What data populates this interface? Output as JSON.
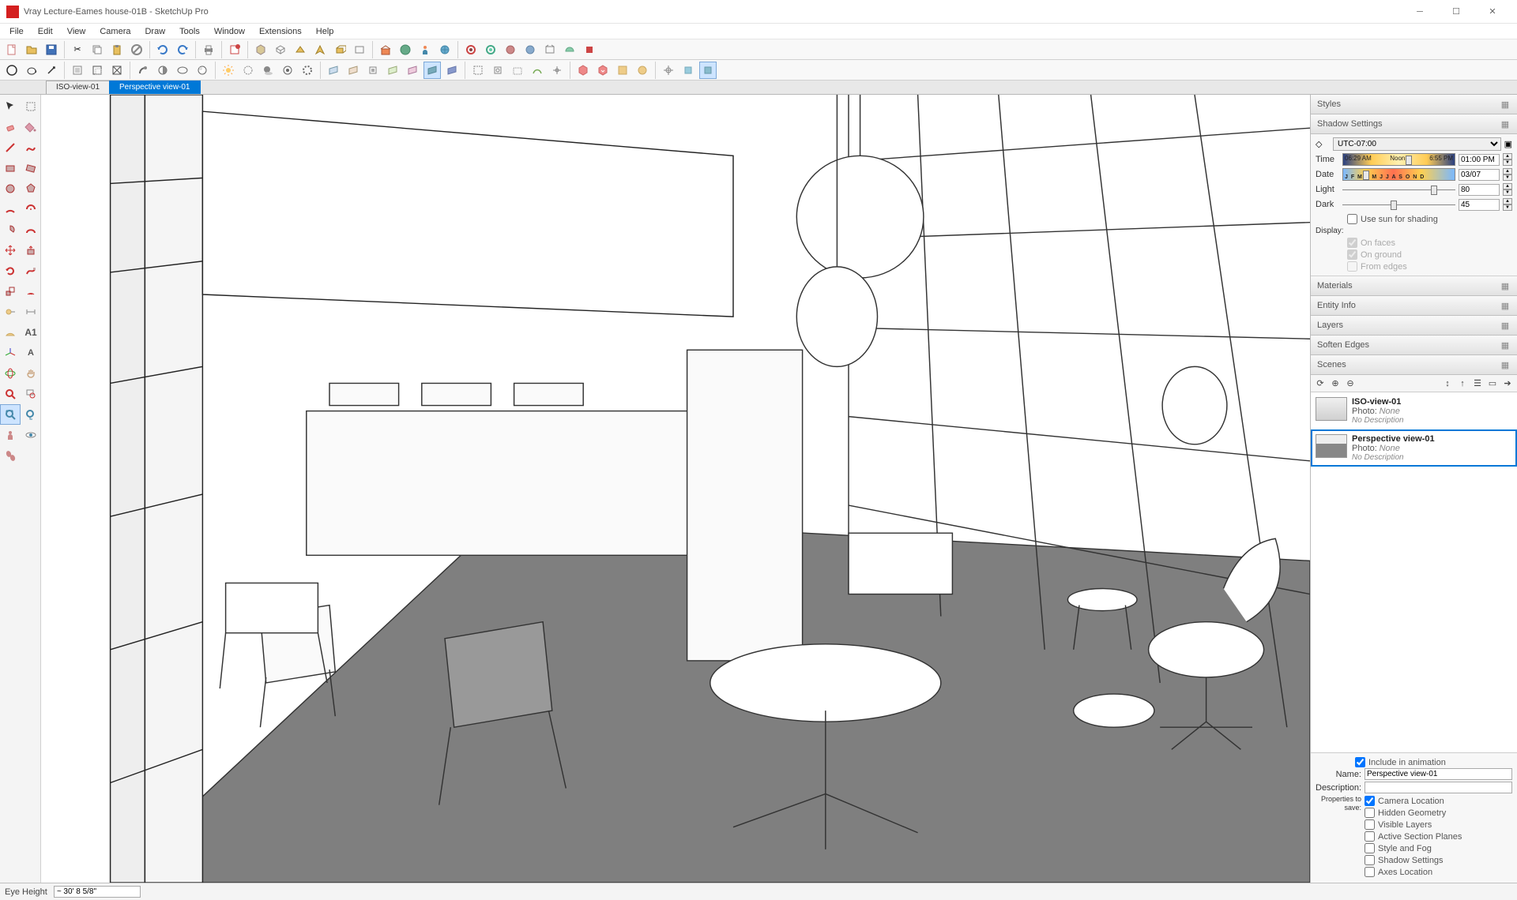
{
  "title": "Vray Lecture-Eames house-01B - SketchUp Pro",
  "menu": [
    "File",
    "Edit",
    "View",
    "Camera",
    "Draw",
    "Tools",
    "Window",
    "Extensions",
    "Help"
  ],
  "scene_tabs": [
    {
      "label": "ISO-view-01",
      "active": false
    },
    {
      "label": "Perspective view-01",
      "active": true
    }
  ],
  "panels": {
    "styles": "Styles",
    "shadow": {
      "title": "Shadow Settings",
      "tz": "UTC-07:00",
      "time_label": "Time",
      "time_start": "06:29 AM",
      "time_noon": "Noon",
      "time_end": "6:55 PM",
      "time_value": "01:00 PM",
      "date_label": "Date",
      "months": "J F M A M J J A S O N D",
      "date_value": "03/07",
      "light_label": "Light",
      "light_value": "80",
      "dark_label": "Dark",
      "dark_value": "45",
      "use_sun": "Use sun for shading",
      "display": "Display:",
      "on_faces": "On faces",
      "on_ground": "On ground",
      "from_edges": "From edges"
    },
    "materials": "Materials",
    "entity_info": "Entity Info",
    "layers": "Layers",
    "soften": "Soften Edges",
    "scenes": {
      "title": "Scenes",
      "items": [
        {
          "name": "ISO-view-01",
          "photo_label": "Photo:",
          "photo": "None",
          "desc": "No Description"
        },
        {
          "name": "Perspective view-01",
          "photo_label": "Photo:",
          "photo": "None",
          "desc": "No Description"
        }
      ],
      "include": "Include in animation",
      "name_label": "Name:",
      "name_value": "Perspective view-01",
      "desc_label": "Description:",
      "props_label": "Properties to save:",
      "props": [
        {
          "label": "Camera Location",
          "checked": true
        },
        {
          "label": "Hidden Geometry",
          "checked": false
        },
        {
          "label": "Visible Layers",
          "checked": false
        },
        {
          "label": "Active Section Planes",
          "checked": false
        },
        {
          "label": "Style and Fog",
          "checked": false
        },
        {
          "label": "Shadow Settings",
          "checked": false
        },
        {
          "label": "Axes Location",
          "checked": false
        }
      ]
    }
  },
  "status": {
    "label": "Eye Height",
    "value": "~ 30' 8 5/8\""
  }
}
